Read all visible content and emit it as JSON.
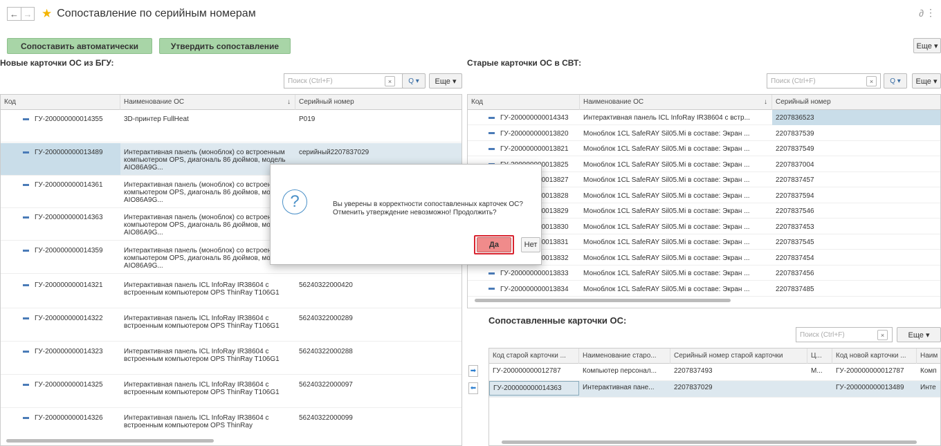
{
  "window": {
    "title": "Сопоставление по серийным номерам",
    "back_icon": "←",
    "forward_icon": "→",
    "star_icon": "★",
    "link_icon": "∂",
    "menu_icon": "⋮"
  },
  "toolbar": {
    "auto_match": "Сопоставить автоматически",
    "approve": "Утвердить сопоставление",
    "more": "Еще ▾"
  },
  "left_panel": {
    "title": "Новые карточки ОС из БГУ:",
    "search_placeholder": "Поиск (Ctrl+F)",
    "clear": "×",
    "search_btn": "Q ▾",
    "more": "Еще ▾",
    "columns": [
      "Код",
      "Наименование ОС",
      "Серийный номер"
    ],
    "sort_icon": "↓",
    "rows": [
      {
        "code": "ГУ-200000000014355",
        "name": "3D-принтер FullHeat",
        "serial": "P019"
      },
      {
        "code": "ГУ-200000000013489",
        "name": "Интерактивная панель (моноблок) со встроенным компьютером OPS, диагональ 86 дюймов, модель AIO86A9G...",
        "serial": "серийный2207837029"
      },
      {
        "code": "ГУ-200000000014361",
        "name": "Интерактивная панель (моноблок) со встроенным компьютером OPS, диагональ 86 дюймов, модель AIO86A9G...",
        "serial": ""
      },
      {
        "code": "ГУ-200000000014363",
        "name": "Интерактивная панель (моноблок) со встроенным компьютером OPS, диагональ 86 дюймов, модель AIO86A9G...",
        "serial": ""
      },
      {
        "code": "ГУ-200000000014359",
        "name": "Интерактивная панель (моноблок) со встроенным компьютером OPS, диагональ 86 дюймов, модель AIO86A9G...",
        "serial": ""
      },
      {
        "code": "ГУ-200000000014321",
        "name": "Интерактивная панель ICL InfoRay IR38604 с встроенным компьютером OPS ThinRay T106G1",
        "serial": "56240322000420"
      },
      {
        "code": "ГУ-200000000014322",
        "name": "Интерактивная панель ICL InfoRay IR38604 с встроенным компьютером OPS ThinRay T106G1",
        "serial": "56240322000289"
      },
      {
        "code": "ГУ-200000000014323",
        "name": "Интерактивная панель ICL InfoRay IR38604 с встроенным компьютером OPS ThinRay T106G1",
        "serial": "56240322000288"
      },
      {
        "code": "ГУ-200000000014325",
        "name": "Интерактивная панель ICL InfoRay IR38604 с встроенным компьютером OPS ThinRay T106G1",
        "serial": "56240322000097"
      },
      {
        "code": "ГУ-200000000014326",
        "name": "Интерактивная панель ICL InfoRay IR38604 с встроенным компьютером OPS ThinRay",
        "serial": "56240322000099"
      }
    ]
  },
  "right_panel": {
    "title": "Старые карточки ОС в СВТ:",
    "search_placeholder": "Поиск (Ctrl+F)",
    "clear": "×",
    "search_btn": "Q ▾",
    "more": "Еще ▾",
    "columns": [
      "Код",
      "Наименование ОС",
      "Серийный номер"
    ],
    "sort_icon": "↓",
    "rows": [
      {
        "code": "ГУ-200000000014343",
        "name": "Интерактивная панель ICL InfoRay IR38604 с встр...",
        "serial": "2207836523"
      },
      {
        "code": "ГУ-200000000013820",
        "name": "Моноблок 1CL SafeRAY Sil05.Mi в составе: Экран ...",
        "serial": "2207837539"
      },
      {
        "code": "ГУ-200000000013821",
        "name": "Моноблок 1CL SafeRAY Sil05.Mi в составе: Экран ...",
        "serial": "2207837549"
      },
      {
        "code": "ГУ-200000000013825",
        "name": "Моноблок 1CL SafeRAY Sil05.Mi в составе: Экран ...",
        "serial": "2207837004"
      },
      {
        "code": "ГУ-200000000013827",
        "name": "Моноблок 1CL SafeRAY Sil05.Mi в составе: Экран ...",
        "serial": "2207837457"
      },
      {
        "code": "ГУ-200000000013828",
        "name": "Моноблок 1CL SafeRAY Sil05.Mi в составе: Экран ...",
        "serial": "2207837594"
      },
      {
        "code": "ГУ-200000000013829",
        "name": "Моноблок 1CL SafeRAY Sil05.Mi в составе: Экран ...",
        "serial": "2207837546"
      },
      {
        "code": "ГУ-200000000013830",
        "name": "Моноблок 1CL SafeRAY Sil05.Mi в составе: Экран ...",
        "serial": "2207837453"
      },
      {
        "code": "ГУ-200000000013831",
        "name": "Моноблок 1CL SafeRAY Sil05.Mi в составе: Экран ...",
        "serial": "2207837545"
      },
      {
        "code": "ГУ-200000000013832",
        "name": "Моноблок 1CL SafeRAY Sil05.Mi в составе: Экран ...",
        "serial": "2207837454"
      },
      {
        "code": "ГУ-200000000013833",
        "name": "Моноблок 1CL SafeRAY Sil05.Mi в составе: Экран ...",
        "serial": "2207837456"
      },
      {
        "code": "ГУ-200000000013834",
        "name": "Моноблок 1CL SafeRAY Sil05.Mi в составе: Экран ...",
        "serial": "2207837485"
      }
    ]
  },
  "matched_panel": {
    "title": "Сопоставленные карточки ОС:",
    "search_placeholder": "Поиск (Ctrl+F)",
    "clear": "×",
    "more": "Еще ▾",
    "columns": [
      "Код старой карточки ...",
      "Наименование старо...",
      "Серийный номер старой карточки",
      "Ц...",
      "Код новой карточки ...",
      "Наим"
    ],
    "rows": [
      {
        "old_code": "ГУ-200000000012787",
        "old_name": "Компьютер персонал...",
        "old_serial": "2207837493",
        "c": "М...",
        "new_code": "ГУ-200000000012787",
        "new_name": "Комп"
      },
      {
        "old_code": "ГУ-200000000014363",
        "old_name": "Интерактивная пане...",
        "old_serial": "2207837029",
        "c": "",
        "new_code": "ГУ-200000000013489",
        "new_name": "Инте"
      }
    ]
  },
  "dialog": {
    "message_line1": "Вы уверены в корректности сопоставленных карточек ОС?",
    "message_line2": "Отменить утверждение невозможно! Продолжить?",
    "yes": "Да",
    "no": "Нет",
    "icon": "?"
  }
}
